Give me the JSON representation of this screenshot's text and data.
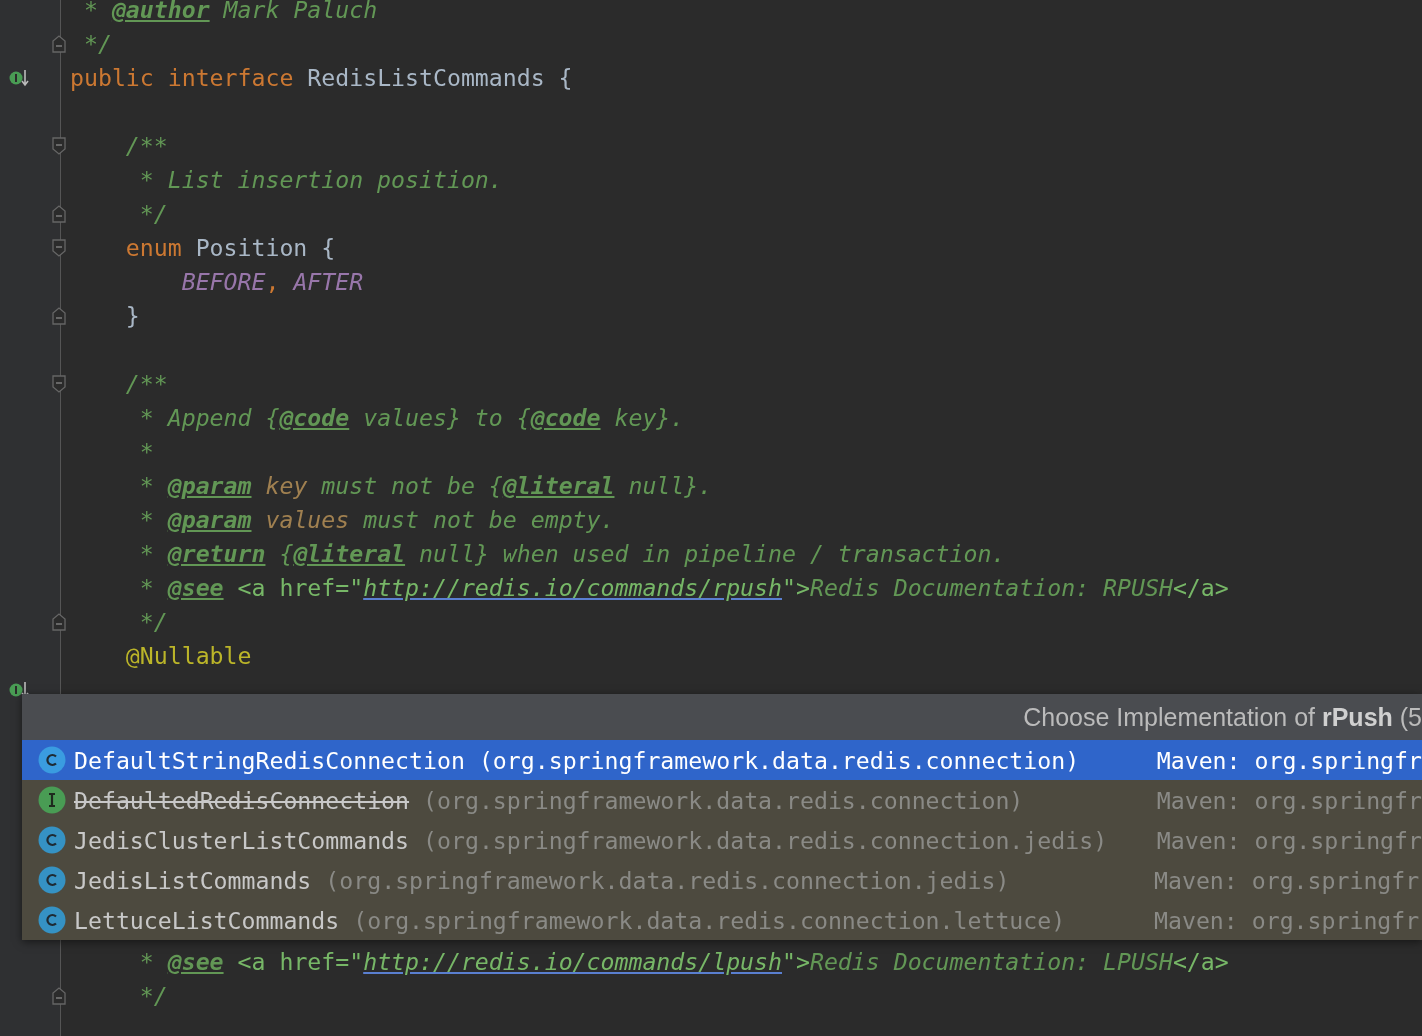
{
  "editor": {
    "lines_above": [
      {
        "kind": "code",
        "tokens": [
          {
            "kind": "comment",
            "text": " * "
          },
          {
            "kind": "tag",
            "text": "@author"
          },
          {
            "kind": "comment",
            "text": " Mark Paluch"
          }
        ]
      },
      {
        "kind": "code",
        "marker": {
          "kind": "fold-end"
        },
        "tokens": [
          {
            "kind": "comment",
            "text": " */"
          }
        ]
      },
      {
        "kind": "code",
        "marker": {
          "kind": "implemented"
        },
        "tokens": [
          {
            "kind": "keyword",
            "text": "public interface "
          },
          {
            "kind": "plain",
            "text": "RedisListCommands {"
          }
        ]
      },
      {
        "kind": "blank"
      },
      {
        "kind": "code",
        "marker": {
          "kind": "fold-start"
        },
        "tokens": [
          {
            "kind": "comment",
            "text": "    /**"
          }
        ]
      },
      {
        "kind": "code",
        "tokens": [
          {
            "kind": "comment",
            "text": "     * List insertion position."
          }
        ]
      },
      {
        "kind": "code",
        "marker": {
          "kind": "fold-end"
        },
        "tokens": [
          {
            "kind": "comment",
            "text": "     */"
          }
        ]
      },
      {
        "kind": "code",
        "marker": {
          "kind": "fold-start"
        },
        "tokens": [
          {
            "kind": "keyword",
            "text": "    enum "
          },
          {
            "kind": "plain",
            "text": "Position {"
          }
        ]
      },
      {
        "kind": "code",
        "tokens": [
          {
            "kind": "constant",
            "text": "        BEFORE"
          },
          {
            "kind": "keyword",
            "text": ", "
          },
          {
            "kind": "constant",
            "text": "AFTER"
          }
        ]
      },
      {
        "kind": "code",
        "marker": {
          "kind": "fold-end"
        },
        "tokens": [
          {
            "kind": "plain",
            "text": "    }"
          }
        ]
      },
      {
        "kind": "blank"
      },
      {
        "kind": "code",
        "marker": {
          "kind": "fold-start"
        },
        "tokens": [
          {
            "kind": "comment",
            "text": "    /**"
          }
        ]
      },
      {
        "kind": "code",
        "tokens": [
          {
            "kind": "comment",
            "text": "     * Append {"
          },
          {
            "kind": "tag",
            "text": "@code"
          },
          {
            "kind": "comment",
            "text": " values} to {"
          },
          {
            "kind": "tag",
            "text": "@code"
          },
          {
            "kind": "comment",
            "text": " key}."
          }
        ]
      },
      {
        "kind": "code",
        "tokens": [
          {
            "kind": "comment",
            "text": "     *"
          }
        ]
      },
      {
        "kind": "code",
        "tokens": [
          {
            "kind": "comment",
            "text": "     * "
          },
          {
            "kind": "tag",
            "text": "@param"
          },
          {
            "kind": "param",
            "text": " key"
          },
          {
            "kind": "comment",
            "text": " must not be {"
          },
          {
            "kind": "tag",
            "text": "@literal"
          },
          {
            "kind": "comment",
            "text": " null}."
          }
        ]
      },
      {
        "kind": "code",
        "tokens": [
          {
            "kind": "comment",
            "text": "     * "
          },
          {
            "kind": "tag",
            "text": "@param"
          },
          {
            "kind": "param",
            "text": " values"
          },
          {
            "kind": "comment",
            "text": " must not be empty."
          }
        ]
      },
      {
        "kind": "code",
        "tokens": [
          {
            "kind": "comment",
            "text": "     * "
          },
          {
            "kind": "tag",
            "text": "@return"
          },
          {
            "kind": "comment",
            "text": " {"
          },
          {
            "kind": "tag",
            "text": "@literal"
          },
          {
            "kind": "comment",
            "text": " null} when used in pipeline / transaction."
          }
        ]
      },
      {
        "kind": "code",
        "tokens": [
          {
            "kind": "comment",
            "text": "     * "
          },
          {
            "kind": "tag",
            "text": "@see"
          },
          {
            "kind": "markup",
            "text": " <a href=\""
          },
          {
            "kind": "link",
            "text": "http://redis.io/commands/rpush"
          },
          {
            "kind": "markup",
            "text": "\">"
          },
          {
            "kind": "comment",
            "text": "Redis Documentation: RPUSH"
          },
          {
            "kind": "markup",
            "text": "</a>"
          }
        ]
      },
      {
        "kind": "code",
        "marker": {
          "kind": "fold-end"
        },
        "tokens": [
          {
            "kind": "comment",
            "text": "     */"
          }
        ]
      },
      {
        "kind": "code",
        "tokens": [
          {
            "kind": "annotation",
            "text": "    @Nullable"
          }
        ]
      },
      {
        "kind": "blank",
        "marker": {
          "kind": "implemented"
        }
      }
    ],
    "lines_below": [
      {
        "kind": "code",
        "tokens": [
          {
            "kind": "comment",
            "text": "     * "
          },
          {
            "kind": "tag",
            "text": "@see"
          },
          {
            "kind": "markup",
            "text": " <a href=\""
          },
          {
            "kind": "link",
            "text": "http://redis.io/commands/lpush"
          },
          {
            "kind": "markup",
            "text": "\">"
          },
          {
            "kind": "comment",
            "text": "Redis Documentation: LPUSH"
          },
          {
            "kind": "markup",
            "text": "</a>"
          }
        ]
      },
      {
        "kind": "code",
        "marker": {
          "kind": "fold-end"
        },
        "tokens": [
          {
            "kind": "comment",
            "text": "     */"
          }
        ]
      }
    ]
  },
  "popup": {
    "title": "Choose Implementation of **rPush** (5",
    "items": [
      {
        "kind": "class",
        "name": "DefaultStringRedisConnection",
        "package": "(org.springframework.data.redis.connection)",
        "location": "Maven: org.springfr",
        "selected": true,
        "deprecated": false
      },
      {
        "kind": "interface",
        "name": "DefaultedRedisConnection",
        "package": "(org.springframework.data.redis.connection)",
        "location": "Maven: org.springfr",
        "selected": false,
        "deprecated": true
      },
      {
        "kind": "class",
        "name": "JedisClusterListCommands",
        "package": "(org.springframework.data.redis.connection.jedis)",
        "location": "Maven: org.springfr",
        "selected": false,
        "deprecated": false
      },
      {
        "kind": "class",
        "name": "JedisListCommands",
        "package": "(org.springframework.data.redis.connection.jedis)",
        "location": "Maven: org.springfr",
        "selected": false,
        "deprecated": false
      },
      {
        "kind": "class",
        "name": "LettuceListCommands",
        "package": "(org.springframework.data.redis.connection.lettuce)",
        "location": "Maven: org.springfr",
        "selected": false,
        "deprecated": false
      }
    ]
  }
}
